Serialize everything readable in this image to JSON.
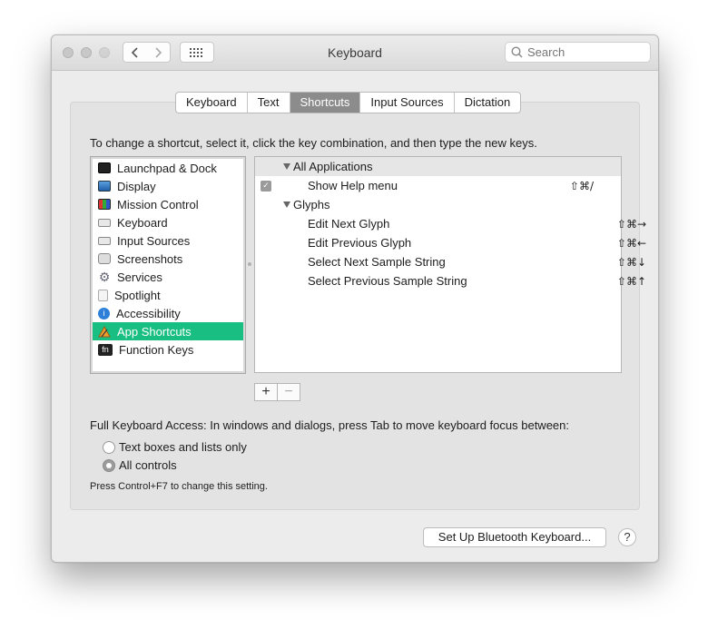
{
  "window": {
    "title": "Keyboard",
    "search_placeholder": "Search",
    "grid_icon": "grid-icon",
    "nav": {
      "back_icon": "chevron-left-icon",
      "forward_icon": "chevron-right-icon"
    }
  },
  "tabs": [
    {
      "label": "Keyboard"
    },
    {
      "label": "Text"
    },
    {
      "label": "Shortcuts",
      "active": true
    },
    {
      "label": "Input Sources"
    },
    {
      "label": "Dictation"
    }
  ],
  "instruction": "To change a shortcut, select it, click the key combination, and then type the new keys.",
  "categories": [
    {
      "label": "Launchpad & Dock",
      "icon": "launchpad-icon"
    },
    {
      "label": "Display",
      "icon": "display-icon"
    },
    {
      "label": "Mission Control",
      "icon": "mission-control-icon"
    },
    {
      "label": "Keyboard",
      "icon": "keyboard-icon"
    },
    {
      "label": "Input Sources",
      "icon": "input-sources-icon"
    },
    {
      "label": "Screenshots",
      "icon": "screenshots-icon"
    },
    {
      "label": "Services",
      "icon": "gear-icon"
    },
    {
      "label": "Spotlight",
      "icon": "spotlight-icon"
    },
    {
      "label": "Accessibility",
      "icon": "accessibility-icon"
    },
    {
      "label": "App Shortcuts",
      "icon": "app-shortcuts-icon",
      "selected": true
    },
    {
      "label": "Function Keys",
      "icon": "fn-icon",
      "icon_text": "fn"
    }
  ],
  "shortcuts": {
    "group1": "All Applications",
    "item1": {
      "label": "Show Help menu",
      "keys": "⇧⌘/",
      "checked": true
    },
    "group2": "Glyphs",
    "items2": [
      {
        "label": "Edit Next Glyph",
        "keys": "⇧⌘→"
      },
      {
        "label": "Edit Previous Glyph",
        "keys": "⇧⌘←"
      },
      {
        "label": "Select Next Sample String",
        "keys": "⇧⌘↓"
      },
      {
        "label": "Select Previous Sample String",
        "keys": "⇧⌘↑"
      }
    ]
  },
  "buttons": {
    "add": "+",
    "remove": "−"
  },
  "full_keyboard_access": {
    "label": "Full Keyboard Access: In windows and dialogs, press Tab to move keyboard focus between:",
    "options": [
      {
        "label": "Text boxes and lists only",
        "selected": false
      },
      {
        "label": "All controls",
        "selected": true
      }
    ],
    "hint": "Press Control+F7 to change this setting."
  },
  "bluetooth_button": "Set Up Bluetooth Keyboard...",
  "help_button": "?"
}
